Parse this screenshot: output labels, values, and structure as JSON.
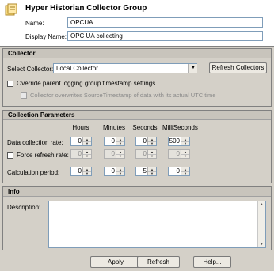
{
  "header": {
    "title": "Hyper Historian Collector Group",
    "name_label": "Name:",
    "name_value": "OPCUA",
    "display_name_label": "Display Name:",
    "display_name_value": "OPC UA collecting"
  },
  "collector": {
    "title": "Collector",
    "select_label": "Select Collector:",
    "selected": "Local Collector",
    "refresh_button": "Refresh Collectors",
    "override_label": "Override parent logging group timestamp settings",
    "override_checked": false,
    "overwrite_label": "Collector overwrites SourceTimestamp of data with its actual UTC time",
    "overwrite_checked": false
  },
  "params": {
    "title": "Collection Parameters",
    "columns": [
      "Hours",
      "Minutes",
      "Seconds",
      "MilliSeconds"
    ],
    "data_rate_label": "Data collection rate:",
    "data_rate": [
      "0",
      "0",
      "0",
      "500"
    ],
    "force_refresh_label": "Force refresh rate:",
    "force_refresh_checked": false,
    "force_refresh": [
      "0",
      "0",
      "0",
      "0"
    ],
    "calc_period_label": "Calculation period:",
    "calc_period": [
      "0",
      "0",
      "5",
      "0"
    ]
  },
  "info": {
    "title": "Info",
    "description_label": "Description:",
    "description_value": ""
  },
  "footer": {
    "apply": "Apply",
    "refresh": "Refresh",
    "help": "Help..."
  }
}
